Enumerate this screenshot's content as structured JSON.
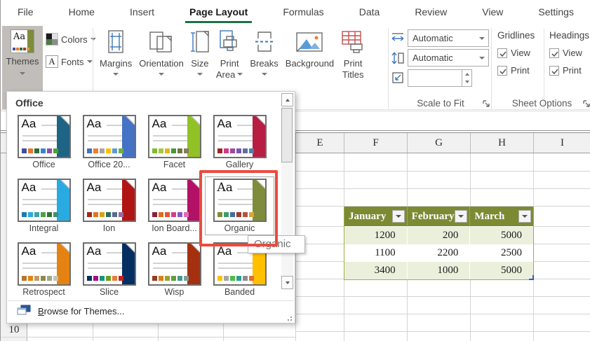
{
  "tabs": {
    "items": [
      {
        "label": "File"
      },
      {
        "label": "Home"
      },
      {
        "label": "Insert"
      },
      {
        "label": "Page Layout"
      },
      {
        "label": "Formulas"
      },
      {
        "label": "Data"
      },
      {
        "label": "Review"
      },
      {
        "label": "View"
      },
      {
        "label": "Settings"
      }
    ],
    "active": "Page Layout",
    "accent_green": "#1e7145"
  },
  "ribbon": {
    "themes_group": {
      "themes": "Themes",
      "colors": "Colors",
      "fonts": "Fonts"
    },
    "page_setup": {
      "margins": "Margins",
      "orientation": "Orientation",
      "size": "Size",
      "print_area_line1": "Print",
      "print_area_line2": "Area",
      "breaks": "Breaks",
      "background": "Background",
      "print_titles_line1": "Print",
      "print_titles_line2": "Titles"
    },
    "scale_to_fit": {
      "label": "Scale to Fit",
      "width_value": "Automatic",
      "height_value": "Automatic",
      "scale_value": ""
    },
    "sheet_options": {
      "label": "Sheet Options",
      "col1": "Gridlines",
      "col2": "Headings",
      "view": "View",
      "print": "Print"
    }
  },
  "gallery": {
    "section_title": "Office",
    "thumb_text": "Aa",
    "tooltip": "Organic",
    "selected": "Organic",
    "highlight_red": "#eb4b3c",
    "browse_accel": "B",
    "browse_rest": "rowse for Themes...",
    "themes": [
      {
        "name": "Office",
        "side": "#1e6484",
        "font": "sans",
        "swatches": [
          "#3a539b",
          "#e8762d",
          "#2e6b3e",
          "#3e7fd6",
          "#8e4fa8",
          "#4ca32e"
        ]
      },
      {
        "name": "Office 20...",
        "side": "#4472c4",
        "font": "sans",
        "swatches": [
          "#4472c4",
          "#ed7d31",
          "#a5a5a5",
          "#ffc000",
          "#5b9bd5",
          "#70ad47"
        ]
      },
      {
        "name": "Facet",
        "side": "#90c226",
        "font": "sans",
        "swatches": [
          "#7dbb2d",
          "#a8c545",
          "#e0b71e",
          "#46963c",
          "#6b7a40",
          "#8a7a5e"
        ]
      },
      {
        "name": "Gallery",
        "side": "#b71e42",
        "font": "sans",
        "swatches": [
          "#9e2828",
          "#d23c82",
          "#9c4ca0",
          "#7a56b8",
          "#60719e",
          "#4e7fa6"
        ]
      },
      {
        "name": "Integral",
        "side": "#29abe2",
        "font": "sans",
        "swatches": [
          "#1c7bb5",
          "#29abe2",
          "#40a2a6",
          "#4ca148",
          "#2f7232",
          "#3f8f7e"
        ]
      },
      {
        "name": "Ion",
        "side": "#b01513",
        "font": "sans",
        "swatches": [
          "#a6251a",
          "#e0761c",
          "#d8a318",
          "#2a6b60",
          "#5a6b8c",
          "#9b6a9b"
        ]
      },
      {
        "name": "Ion Board...",
        "side": "#b31166",
        "font": "sans",
        "swatches": [
          "#8e1c3c",
          "#db6c1e",
          "#e2543c",
          "#d93c8e",
          "#8f54c8",
          "#e06cb4"
        ]
      },
      {
        "name": "Organic",
        "side": "#7e8c3c",
        "font": "serif",
        "swatches": [
          "#7f8c38",
          "#3e9b6e",
          "#41709c",
          "#9e3b33",
          "#b5543b",
          "#dda435"
        ]
      },
      {
        "name": "Retrospect",
        "side": "#e48312",
        "font": "sans",
        "swatches": [
          "#b5772e",
          "#e48312",
          "#bd9b6a",
          "#8a8a4e",
          "#9fa786",
          "#c3c3b2"
        ]
      },
      {
        "name": "Slice",
        "side": "#052f61",
        "font": "sans",
        "swatches": [
          "#052f61",
          "#a50e82",
          "#14967c",
          "#6a9e1f",
          "#e87d37",
          "#c62324"
        ]
      },
      {
        "name": "Wisp",
        "side": "#a53010",
        "font": "sans",
        "swatches": [
          "#9a3a22",
          "#de7e18",
          "#a0a029",
          "#5e9e3c",
          "#3e9b8e",
          "#8a9a96"
        ]
      },
      {
        "name": "Banded",
        "side": "#ffc000",
        "font": "sans",
        "swatches": [
          "#ffc000",
          "#a5a5a5",
          "#4bbd49",
          "#2e9d8c",
          "#8c8c8c",
          "#e66c2c"
        ]
      }
    ]
  },
  "sheet": {
    "columns": [
      "E",
      "F",
      "G",
      "H",
      "I"
    ],
    "row_number": "10",
    "table": {
      "header_bg": "#7c8a33",
      "band_bg": "#ebf0dc",
      "headers": [
        "January",
        "February",
        "March"
      ],
      "rows": [
        [
          "1200",
          "200",
          "5000"
        ],
        [
          "1100",
          "2200",
          "2500"
        ],
        [
          "3400",
          "1000",
          "5000"
        ]
      ]
    }
  }
}
